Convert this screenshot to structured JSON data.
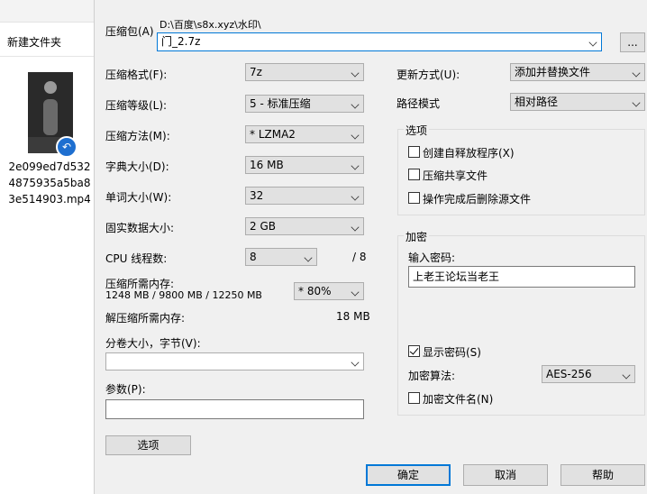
{
  "explorer": {
    "new_folder": "新建文件夹",
    "file_name": "2e099ed7d5324875935a5ba83e514903.mp4"
  },
  "archive": {
    "label": "压缩包(A)",
    "path": "D:\\百度\\s8x.xyz\\水印\\",
    "name": "门_2.7z",
    "browse_label": "..."
  },
  "left": {
    "format_label": "压缩格式(F):",
    "format_value": "7z",
    "level_label": "压缩等级(L):",
    "level_value": "5 - 标准压缩",
    "method_label": "压缩方法(M):",
    "method_value": "* LZMA2",
    "dict_label": "字典大小(D):",
    "dict_value": "16 MB",
    "word_label": "单词大小(W):",
    "word_value": "32",
    "solid_label": "固实数据大小:",
    "solid_value": "2 GB",
    "threads_label": "CPU 线程数:",
    "threads_value": "8",
    "threads_max": "/ 8",
    "mem_label": "压缩所需内存:",
    "mem_value": "1248 MB / 9800 MB / 12250 MB",
    "mem_pct": "* 80%",
    "decomp_label": "解压缩所需内存:",
    "decomp_value": "18 MB",
    "split_label": "分卷大小，字节(V):",
    "split_value": "",
    "params_label": "参数(P):",
    "params_value": "",
    "options_button": "选项"
  },
  "right": {
    "update_label": "更新方式(U):",
    "update_value": "添加并替换文件",
    "path_label": "路径模式",
    "path_value": "相对路径",
    "options_group": "选项",
    "opt_sfx": "创建自释放程序(X)",
    "opt_shared": "压缩共享文件",
    "opt_delete": "操作完成后删除源文件",
    "encrypt_group": "加密",
    "password_label": "输入密码:",
    "password_value": "上老王论坛当老王",
    "show_password": "显示密码(S)",
    "show_password_checked": true,
    "enc_method_label": "加密算法:",
    "enc_method_value": "AES-256",
    "enc_filenames": "加密文件名(N)"
  },
  "buttons": {
    "ok": "确定",
    "cancel": "取消",
    "help": "帮助"
  },
  "colors": {
    "dialog_bg": "#f0f0f0",
    "focus": "#0078d7"
  }
}
